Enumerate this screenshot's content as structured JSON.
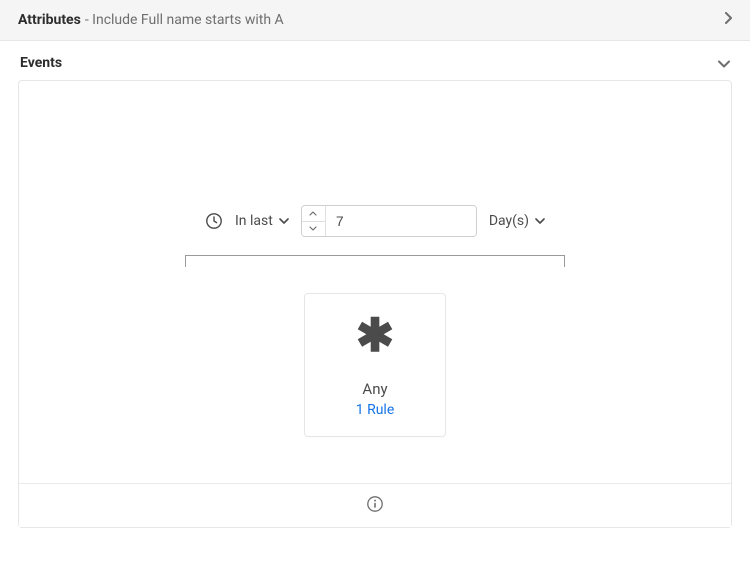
{
  "attributes": {
    "title": "Attributes",
    "subtitle": "- Include Full name starts with A"
  },
  "events": {
    "title": "Events",
    "timeframe": {
      "prefix_label": "In last",
      "value": "7",
      "unit_label": "Day(s)"
    },
    "card": {
      "label": "Any",
      "rules_link": "1 Rule"
    }
  }
}
